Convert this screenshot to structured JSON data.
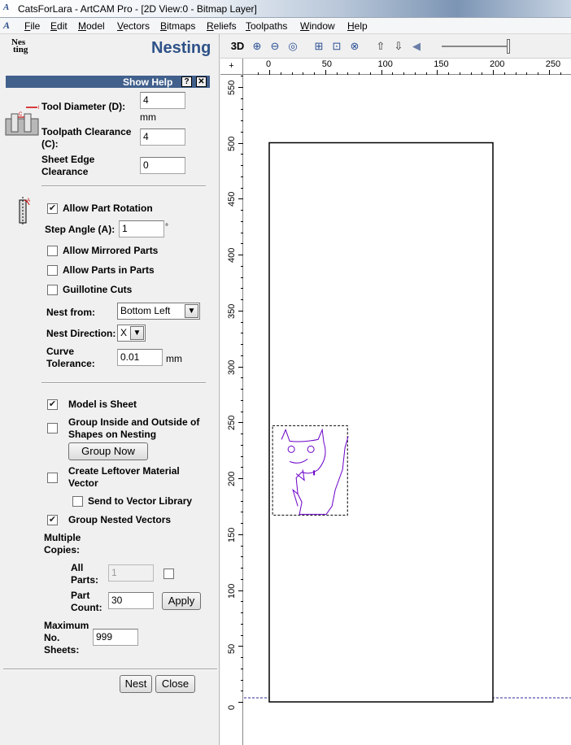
{
  "window": {
    "title": "CatsForLara - ArtCAM Pro - [2D View:0 - Bitmap Layer]"
  },
  "menu": [
    {
      "label": "File",
      "u": "F",
      "rest": "ile"
    },
    {
      "label": "Edit",
      "u": "E",
      "rest": "dit"
    },
    {
      "label": "Model",
      "u": "M",
      "rest": "odel"
    },
    {
      "label": "Vectors",
      "u": "V",
      "rest": "ectors"
    },
    {
      "label": "Bitmaps",
      "u": "B",
      "rest": "itmaps"
    },
    {
      "label": "Reliefs",
      "u": "R",
      "rest": "eliefs"
    },
    {
      "label": "Toolpaths",
      "u": "T",
      "rest": "oolpaths"
    },
    {
      "label": "Window",
      "u": "W",
      "rest": "indow"
    },
    {
      "label": "Help",
      "u": "H",
      "rest": "elp"
    }
  ],
  "panel": {
    "logo": [
      "Nes",
      "ting"
    ],
    "heading": "Nesting",
    "show_help": "Show Help",
    "help_btn": "?",
    "close_btn": "✕",
    "tool_diameter_label": "Tool Diameter (D):",
    "tool_diameter_value": "4",
    "unit_mm": "mm",
    "toolpath_clearance_label_1": "Toolpath Clearance",
    "toolpath_clearance_label_2": "(C):",
    "toolpath_clearance_value": "4",
    "sheet_edge_label_1": "Sheet Edge",
    "sheet_edge_label_2": "Clearance",
    "sheet_edge_value": "0",
    "allow_rotation_label": "Allow Part Rotation",
    "allow_rotation_checked": true,
    "step_angle_label": "Step Angle (A):",
    "step_angle_value": "1",
    "degree": "°",
    "allow_mirrored_label": "Allow Mirrored Parts",
    "allow_mirrored_checked": false,
    "allow_parts_in_parts_label": "Allow Parts in Parts",
    "allow_parts_in_parts_checked": false,
    "guillotine_label": "Guillotine Cuts",
    "guillotine_checked": false,
    "nest_from_label": "Nest from:",
    "nest_from_value": "Bottom Left",
    "nest_direction_label": "Nest Direction:",
    "nest_direction_value": "X",
    "curve_tol_label_1": "Curve",
    "curve_tol_label_2": "Tolerance:",
    "curve_tol_value": "0.01",
    "model_is_sheet_label": "Model is Sheet",
    "model_is_sheet_checked": true,
    "group_inside_label_1": "Group Inside and Outside of",
    "group_inside_label_2": "Shapes on Nesting",
    "group_inside_checked": false,
    "group_now_label": "Group Now",
    "leftover_label_1": "Create Leftover Material",
    "leftover_label_2": "Vector",
    "leftover_checked": false,
    "send_vector_lib_label": "Send to Vector Library",
    "send_vector_lib_checked": false,
    "group_nested_label": "Group Nested Vectors",
    "group_nested_checked": true,
    "multiple_copies_label_1": "Multiple",
    "multiple_copies_label_2": "Copies:",
    "all_parts_label_1": "All",
    "all_parts_label_2": "Parts:",
    "all_parts_value": "1",
    "all_parts_checked": false,
    "part_count_label_1": "Part",
    "part_count_label_2": "Count:",
    "part_count_value": "30",
    "apply_label": "Apply",
    "max_sheets_label_1": "Maximum",
    "max_sheets_label_2": "No.",
    "max_sheets_label_3": "Sheets:",
    "max_sheets_value": "999",
    "nest_label": "Nest",
    "close_label": "Close"
  },
  "view": {
    "toolbar_3d": "3D",
    "ruler_corner": "+",
    "h_ruler": [
      0,
      50,
      100,
      150,
      200,
      250
    ],
    "v_ruler": [
      550,
      500,
      450,
      400,
      350,
      300,
      250,
      200,
      150,
      100,
      50,
      0
    ],
    "sheet": {
      "x_min": 0,
      "x_max": 200,
      "y_min": 0,
      "y_max": 500
    },
    "part_bbox": {
      "x_min": 3,
      "x_max": 70,
      "y_min": 167,
      "y_max": 247
    }
  }
}
